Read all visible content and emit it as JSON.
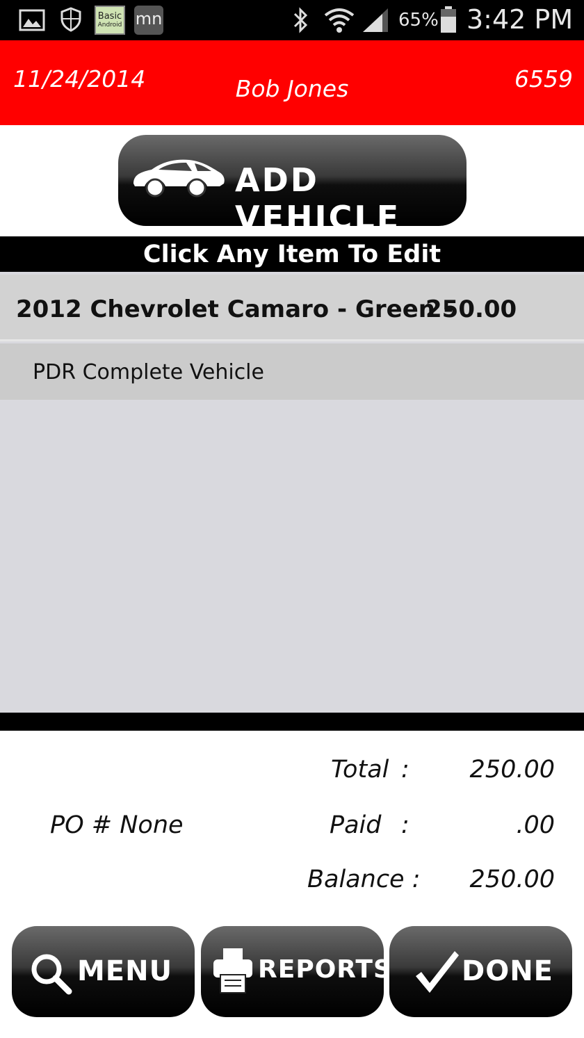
{
  "status_bar": {
    "battery": "65%",
    "time": "3:42 PM",
    "icons": [
      "image-icon",
      "shield-icon",
      "basic-android-app-icon",
      "mn-app-icon",
      "bluetooth-icon",
      "wifi-icon",
      "signal-icon",
      "battery-icon"
    ],
    "app_badge_text_1": "Basic",
    "app_badge_text_2": "Android",
    "mn_text": "mn"
  },
  "header": {
    "date": "11/24/2014",
    "customer": "Bob Jones",
    "number": "6559",
    "color": "#ff0000"
  },
  "add_vehicle": {
    "label": "ADD VEHICLE",
    "icon": "car-icon"
  },
  "edit_bar": {
    "text": "Click Any Item To Edit"
  },
  "items": [
    {
      "description": "2012 Chevrolet Camaro - Green -",
      "amount": "250.00"
    }
  ],
  "services": [
    {
      "label": "PDR Complete Vehicle"
    }
  ],
  "totals": {
    "po": "PO # None",
    "total_label": "Total",
    "total_value": "250.00",
    "paid_label": "Paid",
    "paid_value": ".00",
    "balance_label": "Balance :",
    "balance_value": "250.00",
    "colon": ":"
  },
  "buttons": {
    "menu": {
      "label": "MENU",
      "icon": "search-icon"
    },
    "reports": {
      "label": "REPORTS",
      "icon": "printer-icon"
    },
    "done": {
      "label": "DONE",
      "icon": "checkmark-icon"
    }
  }
}
